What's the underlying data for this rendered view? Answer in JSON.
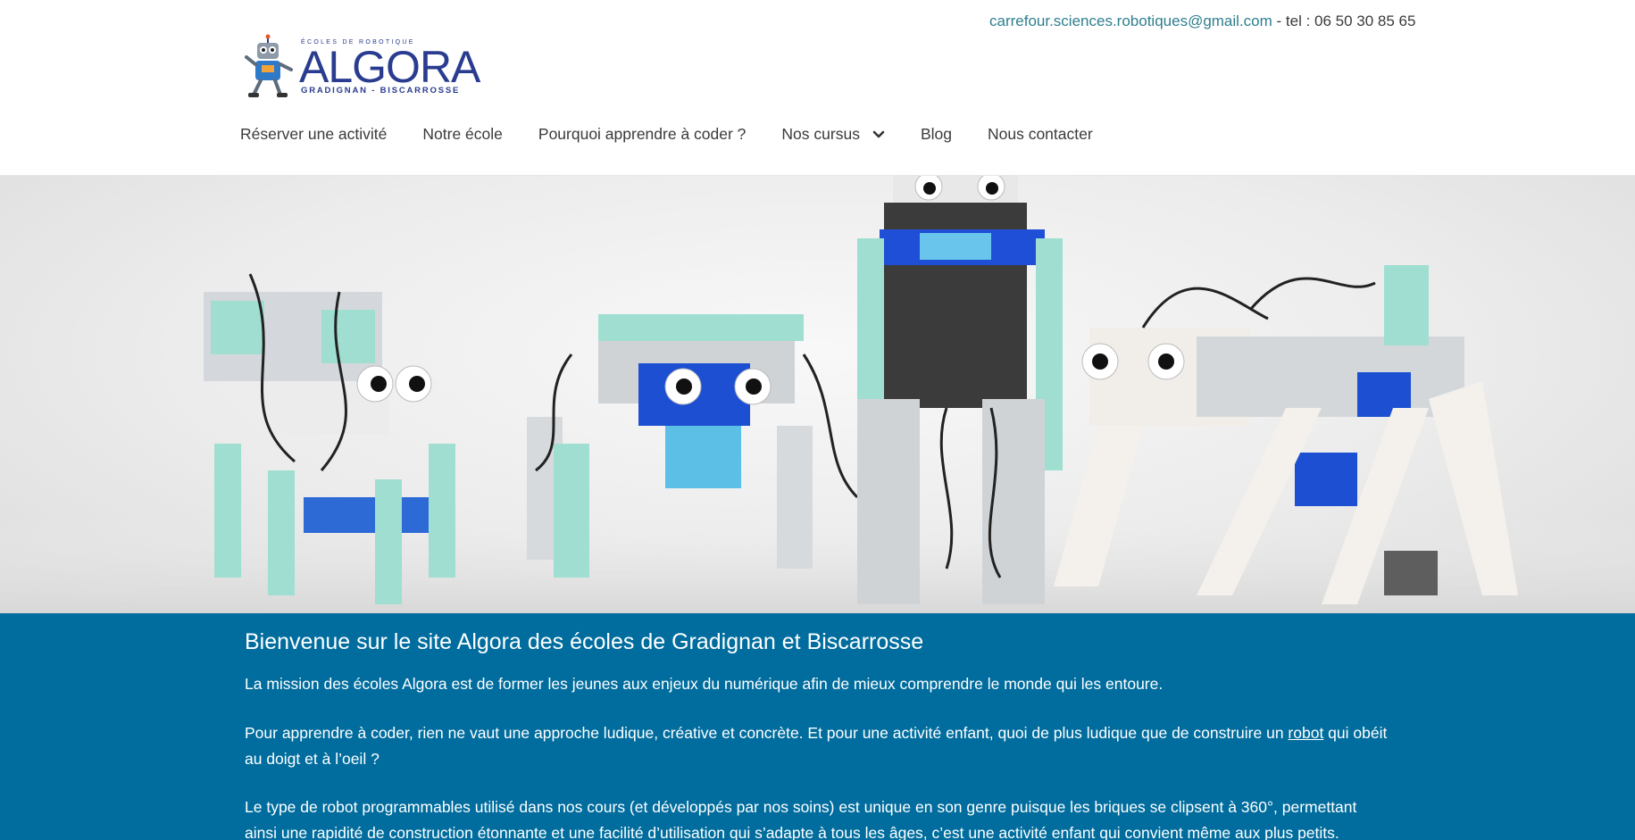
{
  "header": {
    "contact_email": "carrefour.sciences.robotiques@gmail.com",
    "contact_phone": " - tel : 06 50 30 85 65",
    "logo": {
      "top": "ÉCOLES DE ROBOTIQUE",
      "word": "ALGORA",
      "bottom": "GRADIGNAN - BISCARROSSE"
    }
  },
  "nav": {
    "items": [
      {
        "label": "Réserver une activité"
      },
      {
        "label": "Notre école"
      },
      {
        "label": "Pourquoi apprendre à coder ?"
      },
      {
        "label": "Nos cursus",
        "has_dropdown": true
      },
      {
        "label": "Blog"
      },
      {
        "label": "Nous contacter"
      }
    ]
  },
  "hero": {
    "icon": "robots-photo"
  },
  "content": {
    "title": "Bienvenue sur le site Algora des écoles de Gradignan et Biscarrosse",
    "p1": "La mission des écoles Algora est de former les jeunes aux enjeux du numérique afin de mieux comprendre le monde qui les entoure.",
    "p2_before": "Pour apprendre à coder, rien ne vaut une approche ludique, créative et concrète. Et pour une activité enfant, quoi de plus ludique que de construire un ",
    "p2_link": "robot",
    "p2_after": " qui obéit au doigt et à l’oeil ?",
    "p3": "Le type de robot programmables utilisé dans nos cours (et développés par nos soins) est unique en son genre puisque les briques se clipsent à 360°, permettant ainsi une rapidité de construction étonnante et une facilité d’utilisation qui s’adapte à tous les âges, c’est une activité enfant qui convient même aux plus petits."
  },
  "colors": {
    "accent_blue": "#006d9e",
    "link_teal": "#2f7f8f",
    "logo_navy": "#2a3c8f"
  }
}
